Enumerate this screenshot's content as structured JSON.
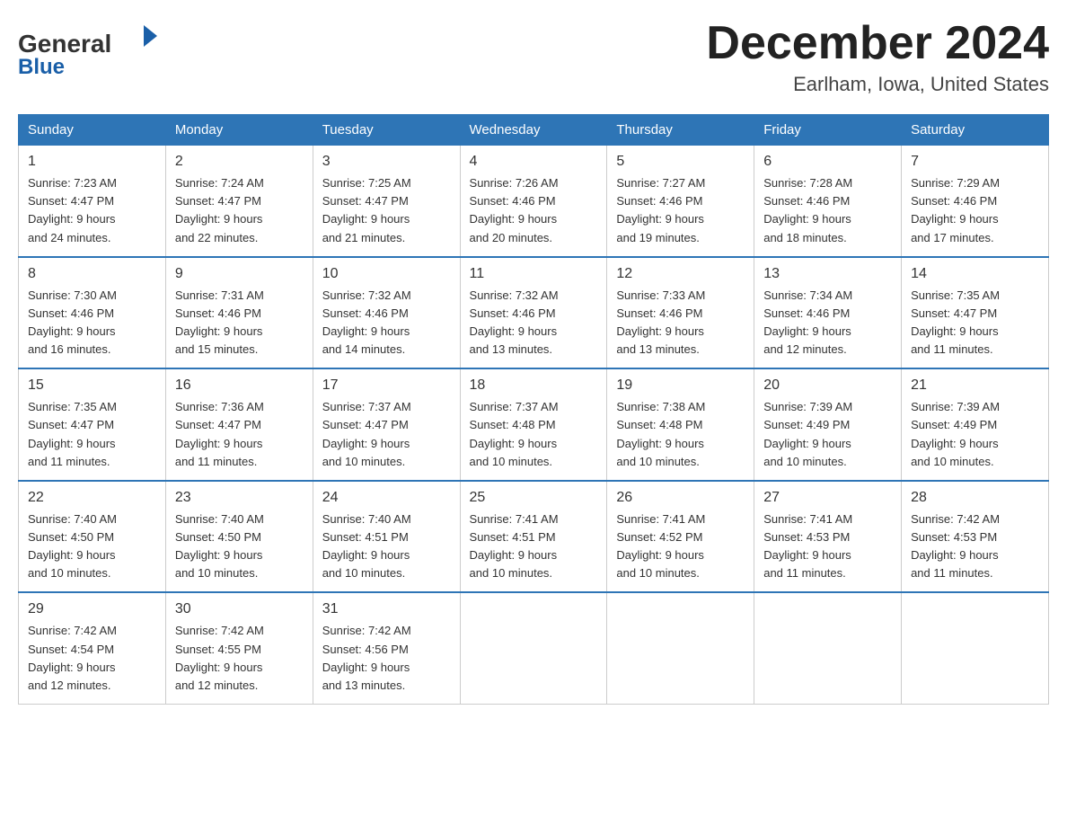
{
  "header": {
    "logo_general": "General",
    "logo_blue": "Blue",
    "month_title": "December 2024",
    "location": "Earlham, Iowa, United States"
  },
  "days_of_week": [
    "Sunday",
    "Monday",
    "Tuesday",
    "Wednesday",
    "Thursday",
    "Friday",
    "Saturday"
  ],
  "weeks": [
    [
      {
        "day": "1",
        "sunrise": "Sunrise: 7:23 AM",
        "sunset": "Sunset: 4:47 PM",
        "daylight": "Daylight: 9 hours",
        "daylight2": "and 24 minutes."
      },
      {
        "day": "2",
        "sunrise": "Sunrise: 7:24 AM",
        "sunset": "Sunset: 4:47 PM",
        "daylight": "Daylight: 9 hours",
        "daylight2": "and 22 minutes."
      },
      {
        "day": "3",
        "sunrise": "Sunrise: 7:25 AM",
        "sunset": "Sunset: 4:47 PM",
        "daylight": "Daylight: 9 hours",
        "daylight2": "and 21 minutes."
      },
      {
        "day": "4",
        "sunrise": "Sunrise: 7:26 AM",
        "sunset": "Sunset: 4:46 PM",
        "daylight": "Daylight: 9 hours",
        "daylight2": "and 20 minutes."
      },
      {
        "day": "5",
        "sunrise": "Sunrise: 7:27 AM",
        "sunset": "Sunset: 4:46 PM",
        "daylight": "Daylight: 9 hours",
        "daylight2": "and 19 minutes."
      },
      {
        "day": "6",
        "sunrise": "Sunrise: 7:28 AM",
        "sunset": "Sunset: 4:46 PM",
        "daylight": "Daylight: 9 hours",
        "daylight2": "and 18 minutes."
      },
      {
        "day": "7",
        "sunrise": "Sunrise: 7:29 AM",
        "sunset": "Sunset: 4:46 PM",
        "daylight": "Daylight: 9 hours",
        "daylight2": "and 17 minutes."
      }
    ],
    [
      {
        "day": "8",
        "sunrise": "Sunrise: 7:30 AM",
        "sunset": "Sunset: 4:46 PM",
        "daylight": "Daylight: 9 hours",
        "daylight2": "and 16 minutes."
      },
      {
        "day": "9",
        "sunrise": "Sunrise: 7:31 AM",
        "sunset": "Sunset: 4:46 PM",
        "daylight": "Daylight: 9 hours",
        "daylight2": "and 15 minutes."
      },
      {
        "day": "10",
        "sunrise": "Sunrise: 7:32 AM",
        "sunset": "Sunset: 4:46 PM",
        "daylight": "Daylight: 9 hours",
        "daylight2": "and 14 minutes."
      },
      {
        "day": "11",
        "sunrise": "Sunrise: 7:32 AM",
        "sunset": "Sunset: 4:46 PM",
        "daylight": "Daylight: 9 hours",
        "daylight2": "and 13 minutes."
      },
      {
        "day": "12",
        "sunrise": "Sunrise: 7:33 AM",
        "sunset": "Sunset: 4:46 PM",
        "daylight": "Daylight: 9 hours",
        "daylight2": "and 13 minutes."
      },
      {
        "day": "13",
        "sunrise": "Sunrise: 7:34 AM",
        "sunset": "Sunset: 4:46 PM",
        "daylight": "Daylight: 9 hours",
        "daylight2": "and 12 minutes."
      },
      {
        "day": "14",
        "sunrise": "Sunrise: 7:35 AM",
        "sunset": "Sunset: 4:47 PM",
        "daylight": "Daylight: 9 hours",
        "daylight2": "and 11 minutes."
      }
    ],
    [
      {
        "day": "15",
        "sunrise": "Sunrise: 7:35 AM",
        "sunset": "Sunset: 4:47 PM",
        "daylight": "Daylight: 9 hours",
        "daylight2": "and 11 minutes."
      },
      {
        "day": "16",
        "sunrise": "Sunrise: 7:36 AM",
        "sunset": "Sunset: 4:47 PM",
        "daylight": "Daylight: 9 hours",
        "daylight2": "and 11 minutes."
      },
      {
        "day": "17",
        "sunrise": "Sunrise: 7:37 AM",
        "sunset": "Sunset: 4:47 PM",
        "daylight": "Daylight: 9 hours",
        "daylight2": "and 10 minutes."
      },
      {
        "day": "18",
        "sunrise": "Sunrise: 7:37 AM",
        "sunset": "Sunset: 4:48 PM",
        "daylight": "Daylight: 9 hours",
        "daylight2": "and 10 minutes."
      },
      {
        "day": "19",
        "sunrise": "Sunrise: 7:38 AM",
        "sunset": "Sunset: 4:48 PM",
        "daylight": "Daylight: 9 hours",
        "daylight2": "and 10 minutes."
      },
      {
        "day": "20",
        "sunrise": "Sunrise: 7:39 AM",
        "sunset": "Sunset: 4:49 PM",
        "daylight": "Daylight: 9 hours",
        "daylight2": "and 10 minutes."
      },
      {
        "day": "21",
        "sunrise": "Sunrise: 7:39 AM",
        "sunset": "Sunset: 4:49 PM",
        "daylight": "Daylight: 9 hours",
        "daylight2": "and 10 minutes."
      }
    ],
    [
      {
        "day": "22",
        "sunrise": "Sunrise: 7:40 AM",
        "sunset": "Sunset: 4:50 PM",
        "daylight": "Daylight: 9 hours",
        "daylight2": "and 10 minutes."
      },
      {
        "day": "23",
        "sunrise": "Sunrise: 7:40 AM",
        "sunset": "Sunset: 4:50 PM",
        "daylight": "Daylight: 9 hours",
        "daylight2": "and 10 minutes."
      },
      {
        "day": "24",
        "sunrise": "Sunrise: 7:40 AM",
        "sunset": "Sunset: 4:51 PM",
        "daylight": "Daylight: 9 hours",
        "daylight2": "and 10 minutes."
      },
      {
        "day": "25",
        "sunrise": "Sunrise: 7:41 AM",
        "sunset": "Sunset: 4:51 PM",
        "daylight": "Daylight: 9 hours",
        "daylight2": "and 10 minutes."
      },
      {
        "day": "26",
        "sunrise": "Sunrise: 7:41 AM",
        "sunset": "Sunset: 4:52 PM",
        "daylight": "Daylight: 9 hours",
        "daylight2": "and 10 minutes."
      },
      {
        "day": "27",
        "sunrise": "Sunrise: 7:41 AM",
        "sunset": "Sunset: 4:53 PM",
        "daylight": "Daylight: 9 hours",
        "daylight2": "and 11 minutes."
      },
      {
        "day": "28",
        "sunrise": "Sunrise: 7:42 AM",
        "sunset": "Sunset: 4:53 PM",
        "daylight": "Daylight: 9 hours",
        "daylight2": "and 11 minutes."
      }
    ],
    [
      {
        "day": "29",
        "sunrise": "Sunrise: 7:42 AM",
        "sunset": "Sunset: 4:54 PM",
        "daylight": "Daylight: 9 hours",
        "daylight2": "and 12 minutes."
      },
      {
        "day": "30",
        "sunrise": "Sunrise: 7:42 AM",
        "sunset": "Sunset: 4:55 PM",
        "daylight": "Daylight: 9 hours",
        "daylight2": "and 12 minutes."
      },
      {
        "day": "31",
        "sunrise": "Sunrise: 7:42 AM",
        "sunset": "Sunset: 4:56 PM",
        "daylight": "Daylight: 9 hours",
        "daylight2": "and 13 minutes."
      },
      null,
      null,
      null,
      null
    ]
  ]
}
